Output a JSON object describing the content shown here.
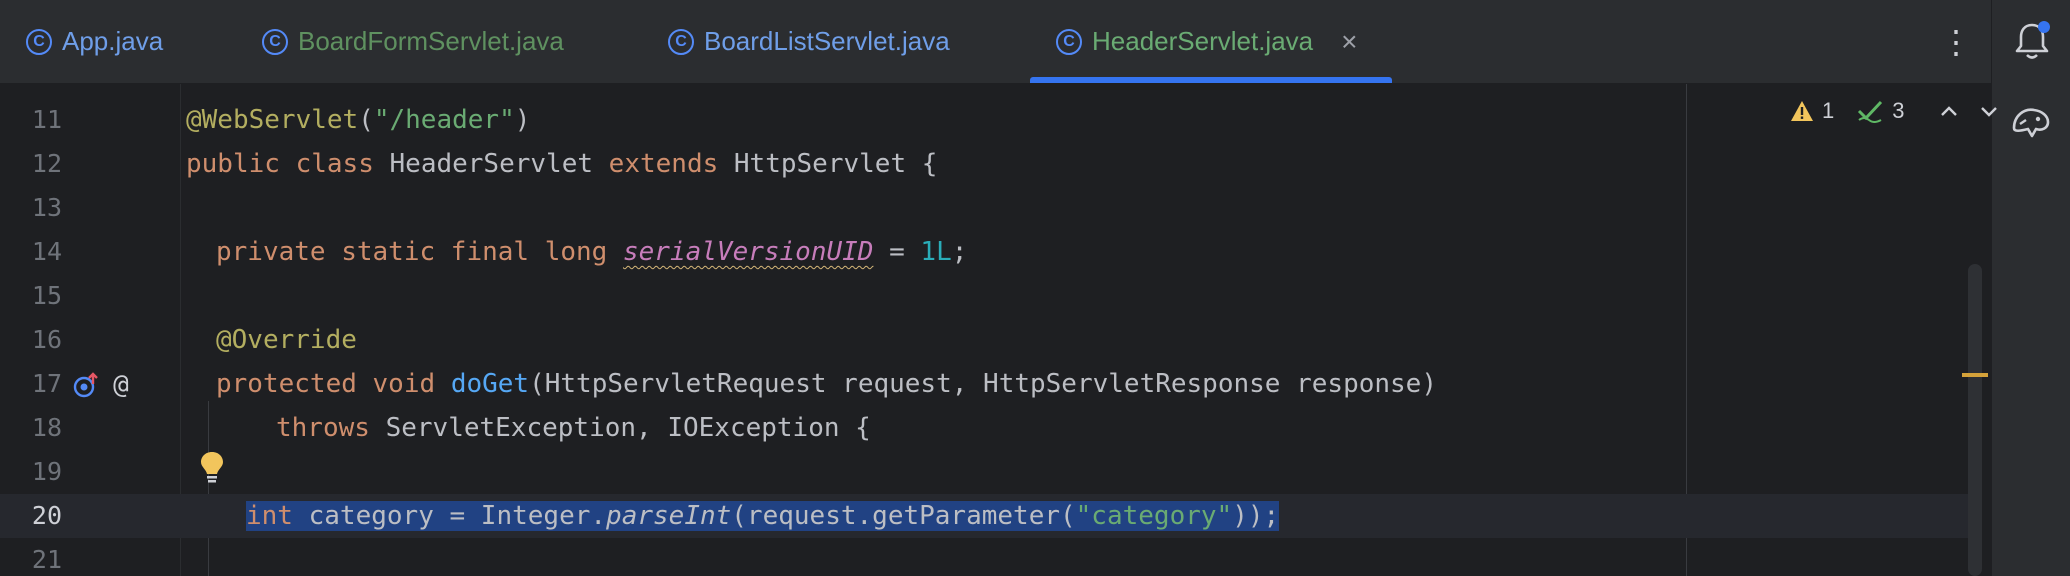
{
  "tabs": [
    {
      "label": "App.java",
      "color": "#6f9ee8",
      "active": false
    },
    {
      "label": "BoardFormServlet.java",
      "color": "#5f9160",
      "active": false
    },
    {
      "label": "BoardListServlet.java",
      "color": "#6f9ee8",
      "active": false
    },
    {
      "label": "HeaderServlet.java",
      "color": "#6aab73",
      "active": true
    }
  ],
  "tab_class_glyph": "C",
  "tab_close_glyph": "×",
  "more_glyph": "⋮",
  "inspections": {
    "warnings": "1",
    "passed": "3"
  },
  "gutter": {
    "at_glyph": "@"
  },
  "lines": [
    {
      "n": "11"
    },
    {
      "n": "12"
    },
    {
      "n": "13"
    },
    {
      "n": "14"
    },
    {
      "n": "15"
    },
    {
      "n": "16"
    },
    {
      "n": "17"
    },
    {
      "n": "18"
    },
    {
      "n": "19"
    },
    {
      "n": "20"
    },
    {
      "n": "21"
    }
  ],
  "code": {
    "l11_ann": "@WebServlet",
    "l11_open": "(",
    "l11_str": "\"/header\"",
    "l11_close": ")",
    "l12_kw1": "public",
    "l12_kw2": "class",
    "l12_name": "HeaderServlet",
    "l12_kw3": "extends",
    "l12_super": "HttpServlet {",
    "l14_kw": "private static final long",
    "l14_field": "serialVersionUID",
    "l14_eq": " = ",
    "l14_num": "1L",
    "l14_semi": ";",
    "l16_ann": "@Override",
    "l17_kw": "protected void",
    "l17_fn": "doGet",
    "l17_rest": "(HttpServletRequest request, HttpServletResponse response)",
    "l18_kw": "throws",
    "l18_rest": " ServletException, IOException {",
    "l20_kw": "int",
    "l20_a": " category = Integer.",
    "l20_m": "parseInt",
    "l20_b": "(request.getParameter(",
    "l20_str": "\"category\"",
    "l20_c": "));"
  },
  "colors": {
    "accent": "#3574f0",
    "keyword": "#cf8e6d",
    "annotation": "#b3ae60",
    "string": "#6aab73",
    "number": "#2aacb8",
    "selection": "#214283"
  }
}
